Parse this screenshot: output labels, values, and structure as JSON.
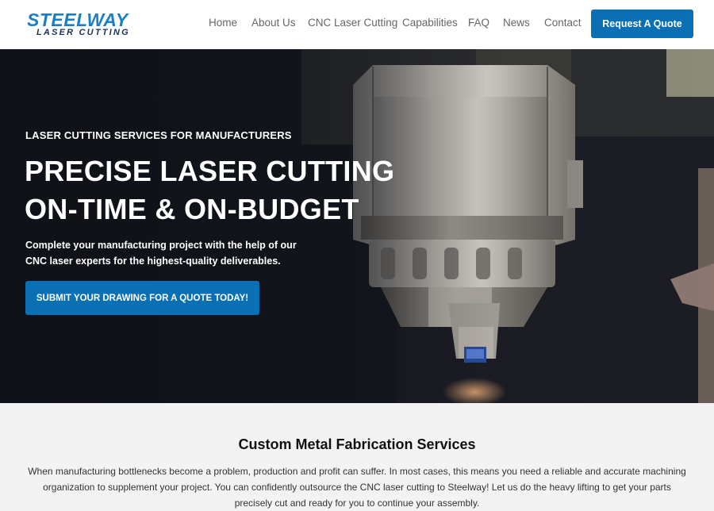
{
  "header": {
    "logo_text": "STEELWAY",
    "logo_subtext": "LASER CUTTING",
    "nav": [
      {
        "label": "Home"
      },
      {
        "label": "About Us"
      },
      {
        "label": "CNC Laser Cutting"
      },
      {
        "label": "Capabilities"
      },
      {
        "label": "FAQ"
      },
      {
        "label": "News"
      },
      {
        "label": "Contact"
      }
    ],
    "cta_label": "Request A Quote"
  },
  "hero": {
    "eyebrow": "LASER CUTTING SERVICES FOR MANUFACTURERS",
    "title_line1": "PRECISE LASER CUTTING",
    "title_line2": "ON-TIME & ON-BUDGET",
    "desc_line1": "Complete your manufacturing project with the help of our",
    "desc_line2": "CNC laser experts for the highest-quality deliverables.",
    "button_label": "SUBMIT YOUR DRAWING FOR A QUOTE TODAY!"
  },
  "services": {
    "title": "Custom Metal Fabrication Services",
    "text": "When manufacturing bottlenecks become a problem, production and profit can suffer. In most cases, this means you need a reliable and accurate machining organization to supplement your project. You can confidently outsource the CNC laser cutting to Steelway! Let us do the heavy lifting to get your parts precisely cut and ready for you to continue your assembly."
  },
  "colors": {
    "accent": "#0a6fb3",
    "logo_blue": "#1a7fc4",
    "logo_navy": "#16325c",
    "nav_text": "#666666"
  }
}
